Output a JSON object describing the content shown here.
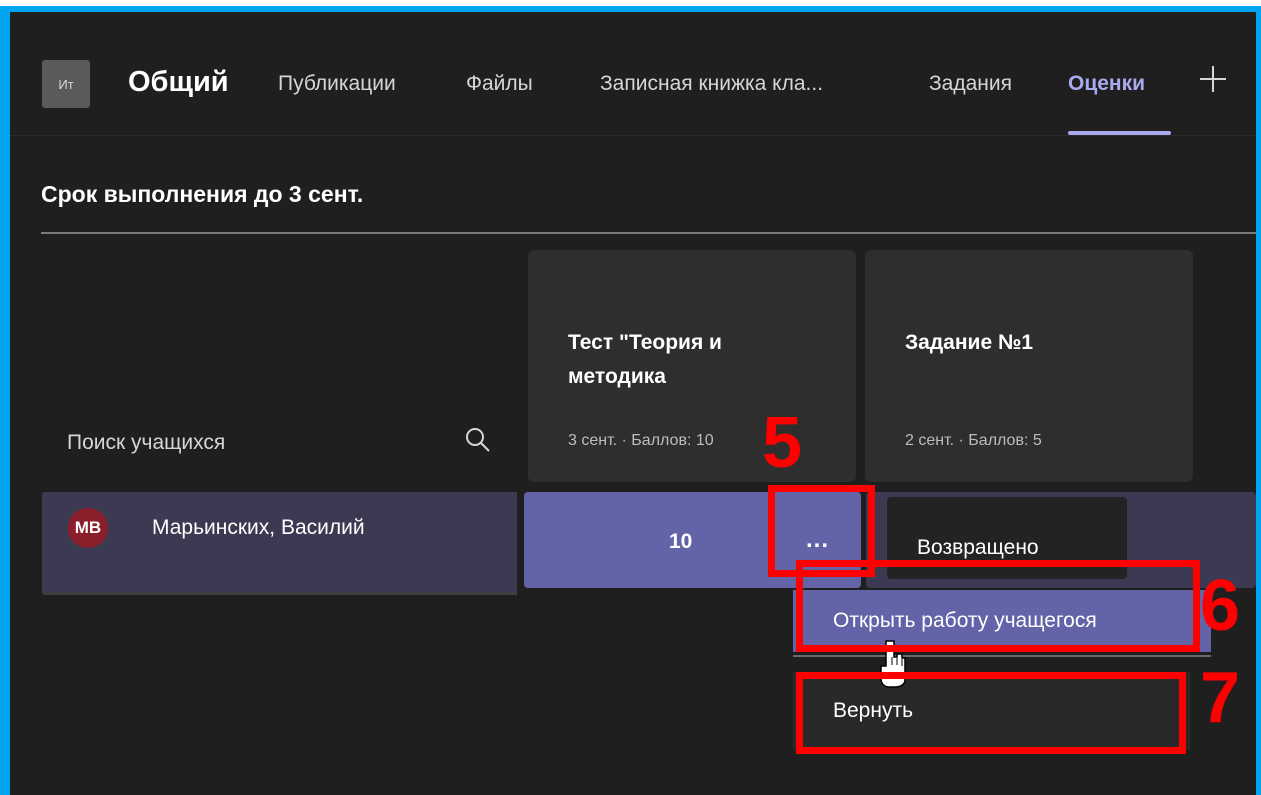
{
  "header": {
    "team_initials": "Ит",
    "channel_name": "Общий",
    "tabs": [
      {
        "label": "Публикации"
      },
      {
        "label": "Файлы"
      },
      {
        "label": "Записная книжка кла..."
      },
      {
        "label": "Задания"
      },
      {
        "label": "Оценки",
        "active": true
      }
    ],
    "add_tab_icon": "plus-icon"
  },
  "section": {
    "title": "Срок выполнения до 3 сент."
  },
  "search": {
    "placeholder": "Поиск учащихся",
    "icon": "search-icon"
  },
  "assignments": [
    {
      "title": "Тест \"Теория и методика",
      "meta": "3 сент. · Баллов: 10"
    },
    {
      "title": "Задание №1",
      "meta": "2 сент. · Баллов: 5"
    }
  ],
  "student": {
    "initials": "МВ",
    "name": "Марьинских, Василий",
    "grade": "10",
    "more_label": "...",
    "status": "Возвращено"
  },
  "context_menu": {
    "items": [
      {
        "label": "Открыть работу учащегося"
      },
      {
        "label": "Вернуть"
      }
    ]
  },
  "annotations": {
    "numbers": [
      "5",
      "6",
      "7"
    ]
  },
  "colors": {
    "accent": "#6264a7",
    "tab_active": "#a9a9ee",
    "annotation": "#ff0000",
    "frame": "#00a4ef"
  }
}
